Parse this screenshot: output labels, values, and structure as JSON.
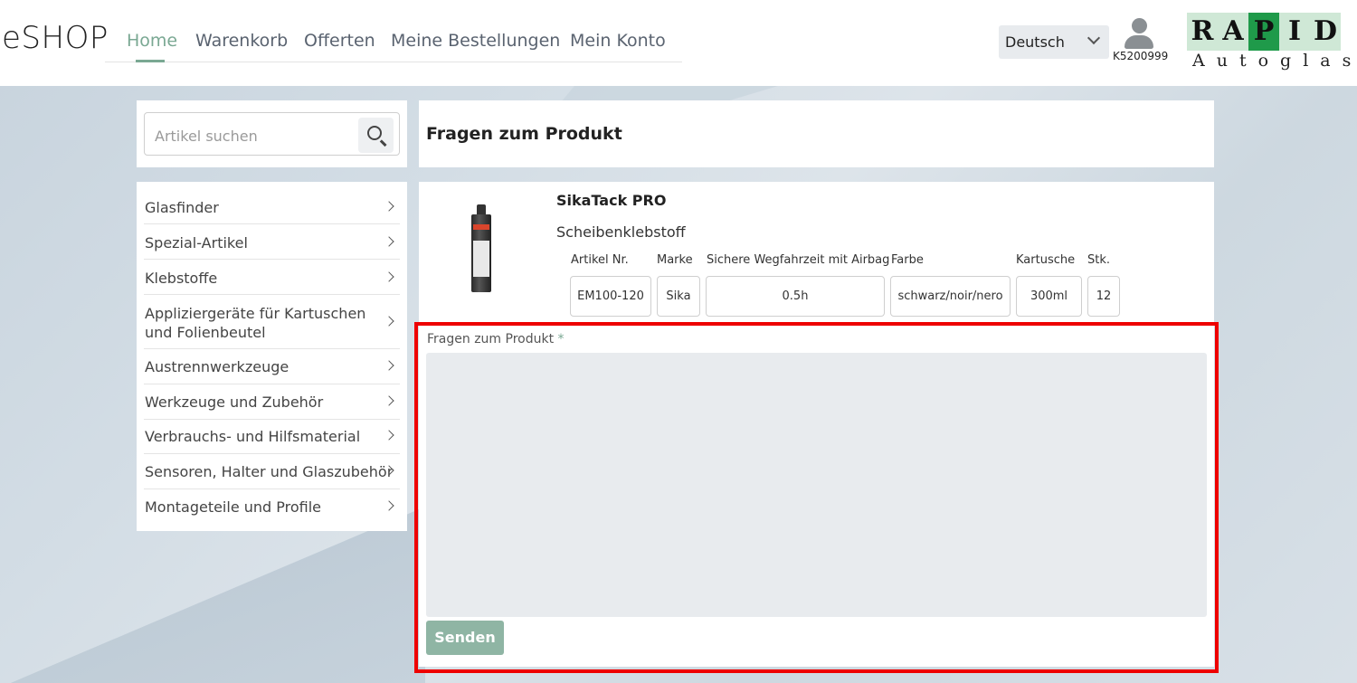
{
  "header": {
    "logo": "eSHOP",
    "nav": [
      "Home",
      "Warenkorb",
      "Offerten",
      "Meine Bestellungen",
      "Mein Konto"
    ],
    "language": "Deutsch",
    "user_id": "K5200999",
    "brand_letters": [
      "R",
      "A",
      "P",
      "I",
      "D"
    ],
    "brand_sub": "Autoglas"
  },
  "search": {
    "placeholder": "Artikel suchen"
  },
  "sidebar": {
    "items": [
      "Glasfinder",
      "Spezial-Artikel",
      "Klebstoffe",
      "Appliziergeräte für Kartuschen und Folienbeutel",
      "Austrennwerkzeuge",
      "Werkzeuge und Zubehör",
      "Verbrauchs- und Hilfsmaterial",
      "Sensoren, Halter und Glaszubehör",
      "Montageteile und Profile"
    ]
  },
  "main": {
    "title": "Fragen zum Produkt",
    "product": {
      "name": "SikaTack PRO",
      "description": "Scheibenklebstoff",
      "specs": [
        {
          "label": "Artikel Nr.",
          "value": "EM100-120"
        },
        {
          "label": "Marke",
          "value": "Sika"
        },
        {
          "label": "Sichere Wegfahrzeit mit Airbag",
          "value": "0.5h"
        },
        {
          "label": "Farbe",
          "value": "schwarz/noir/nero"
        },
        {
          "label": "Kartusche",
          "value": "300ml"
        },
        {
          "label": "Stk.",
          "value": "12"
        }
      ]
    },
    "question_label": "Fragen zum Produkt",
    "required_mark": "*",
    "question_value": "",
    "submit_label": "Senden"
  },
  "colors": {
    "accent": "#7aa893",
    "button": "#8fb5a4",
    "highlight": "#ee0000"
  }
}
